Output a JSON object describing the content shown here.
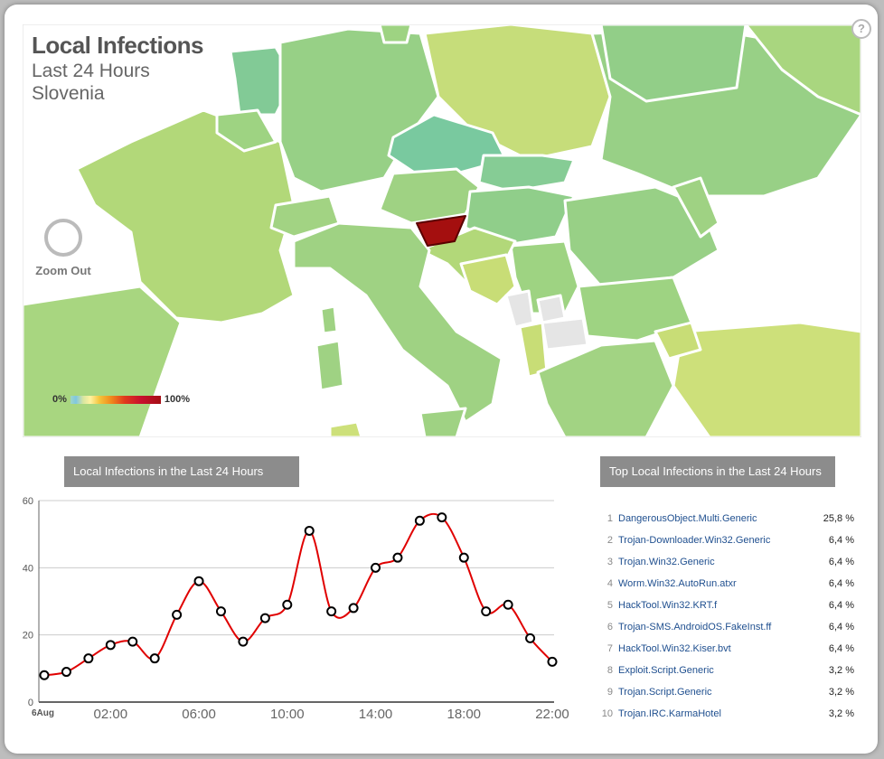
{
  "map": {
    "title": "Local Infections",
    "subtitle": "Last 24 Hours",
    "country": "Slovenia",
    "zoom_out_label": "Zoom Out",
    "help_label": "?",
    "legend": {
      "min_label": "0%",
      "max_label": "100%"
    },
    "colors": {
      "selected_fill": "#a40f0f",
      "land_light": "#c8dd76",
      "land_mid": "#95cf85",
      "land_teal": "#76c89a",
      "no_data": "#e5e5e5",
      "border": "#ffffff",
      "outline": "#8c8c8c"
    }
  },
  "chart_data": {
    "type": "line",
    "title": "Local Infections in the Last 24 Hours",
    "x_start_label": "6Aug",
    "x_tick_labels": [
      "02:00",
      "06:00",
      "10:00",
      "14:00",
      "18:00",
      "22:00"
    ],
    "ylim": [
      0,
      60
    ],
    "y_ticks": [
      0,
      20,
      40,
      60
    ],
    "series": [
      {
        "values": [
          8,
          9,
          13,
          17,
          18,
          13,
          26,
          36,
          27,
          18,
          25,
          29,
          51,
          27,
          28,
          40,
          43,
          54,
          55,
          43,
          27,
          29,
          19,
          12
        ],
        "color": "#e00000"
      }
    ],
    "grid": true
  },
  "top": {
    "title": "Top Local Infections in the Last 24 Hours",
    "items": [
      {
        "rank": "1",
        "name": "DangerousObject.Multi.Generic",
        "pct": "25,8 %"
      },
      {
        "rank": "2",
        "name": "Trojan-Downloader.Win32.Generic",
        "pct": "6,4 %"
      },
      {
        "rank": "3",
        "name": "Trojan.Win32.Generic",
        "pct": "6,4 %"
      },
      {
        "rank": "4",
        "name": "Worm.Win32.AutoRun.atxr",
        "pct": "6,4 %"
      },
      {
        "rank": "5",
        "name": "HackTool.Win32.KRT.f",
        "pct": "6,4 %"
      },
      {
        "rank": "6",
        "name": "Trojan-SMS.AndroidOS.FakeInst.ff",
        "pct": "6,4 %"
      },
      {
        "rank": "7",
        "name": "HackTool.Win32.Kiser.bvt",
        "pct": "6,4 %"
      },
      {
        "rank": "8",
        "name": "Exploit.Script.Generic",
        "pct": "3,2 %"
      },
      {
        "rank": "9",
        "name": "Trojan.Script.Generic",
        "pct": "3,2 %"
      },
      {
        "rank": "10",
        "name": "Trojan.IRC.KarmaHotel",
        "pct": "3,2 %"
      }
    ]
  }
}
